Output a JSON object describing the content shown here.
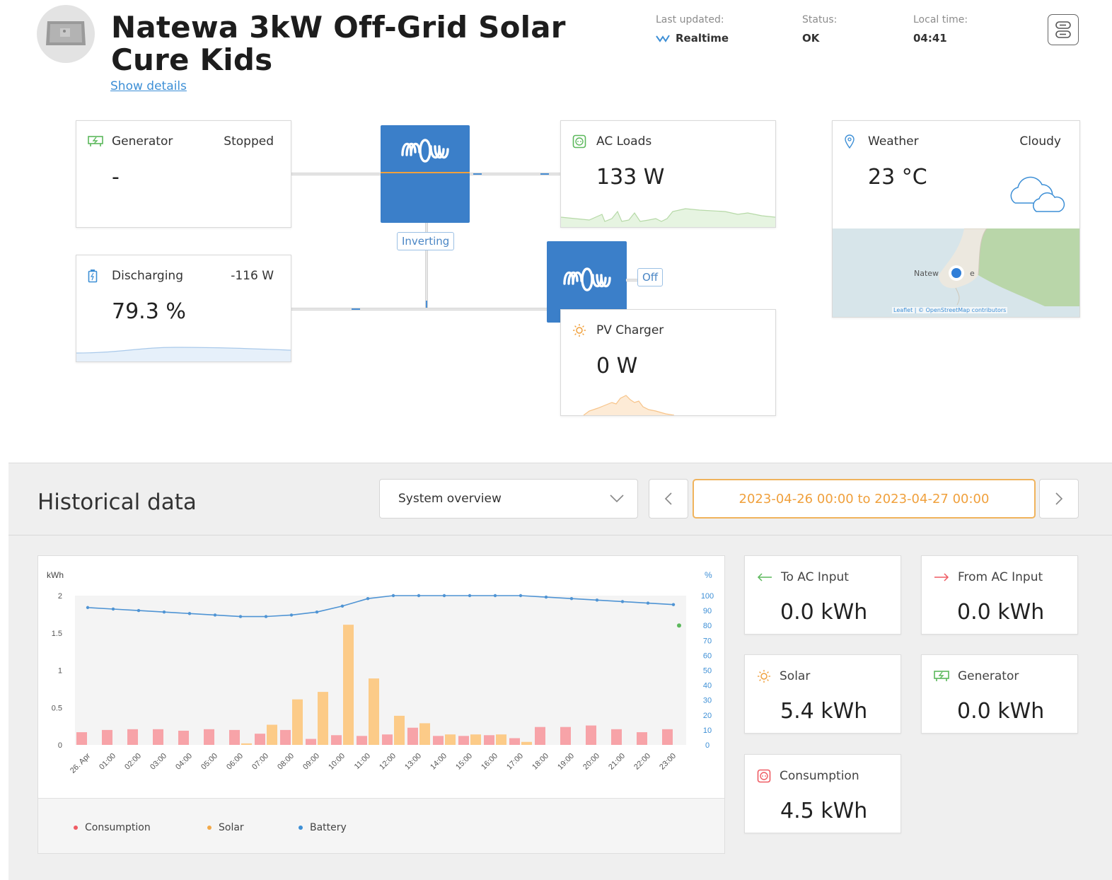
{
  "site": {
    "title": "Natewa 3kW Off-Grid Solar Cure Kids",
    "show_details": "Show details",
    "last_updated_label": "Last updated:",
    "last_updated_value": "Realtime",
    "status_label": "Status:",
    "status_value": "OK",
    "local_time_label": "Local time:",
    "local_time_value": "04:41"
  },
  "widgets": {
    "generator": {
      "label": "Generator",
      "state": "Stopped",
      "value": "-"
    },
    "battery": {
      "label": "Discharging",
      "power": "-116 W",
      "value": "79.3 %"
    },
    "ac_loads": {
      "label": "AC Loads",
      "value": "133 W"
    },
    "pv_charger": {
      "label": "PV Charger",
      "value": "0 W"
    },
    "inverter": {
      "state": "Inverting"
    },
    "solar_charger": {
      "state": "Off"
    },
    "weather": {
      "label": "Weather",
      "condition": "Cloudy",
      "temperature": "23 °C"
    },
    "map": {
      "place_label": "Natew",
      "place_label_2": "e",
      "attribution": "Leaflet | © OpenStreetMap contributors"
    }
  },
  "historical": {
    "title": "Historical data",
    "dropdown_value": "System overview",
    "date_range": "2023-04-26 00:00 to 2023-04-27 00:00"
  },
  "stats": {
    "to_ac_input": {
      "label": "To AC Input",
      "value": "0.0 kWh"
    },
    "from_ac_input": {
      "label": "From AC Input",
      "value": "0.0 kWh"
    },
    "solar": {
      "label": "Solar",
      "value": "5.4 kWh"
    },
    "generator": {
      "label": "Generator",
      "value": "0.0 kWh"
    },
    "consumption": {
      "label": "Consumption",
      "value": "4.5 kWh"
    }
  },
  "colors": {
    "consumption": "#f7a3a8",
    "solar": "#fccb88",
    "battery": "#4f94d4",
    "accent_blue": "#3b7fc9",
    "accent_orange": "#f0a03c"
  },
  "chart_data": {
    "type": "bar",
    "ylabel_left": "kWh",
    "ylabel_right": "%",
    "ylim_left": [
      0,
      2
    ],
    "ylim_right": [
      0,
      100
    ],
    "left_ticks": [
      "0",
      "0.5",
      "1",
      "1.5",
      "2"
    ],
    "right_ticks": [
      "0",
      "10",
      "20",
      "30",
      "40",
      "50",
      "60",
      "70",
      "80",
      "90",
      "100"
    ],
    "categories": [
      "26. Apr",
      "01:00",
      "02:00",
      "03:00",
      "04:00",
      "05:00",
      "06:00",
      "07:00",
      "08:00",
      "09:00",
      "10:00",
      "11:00",
      "12:00",
      "13:00",
      "14:00",
      "15:00",
      "16:00",
      "17:00",
      "18:00",
      "19:00",
      "20:00",
      "21:00",
      "22:00",
      "23:00"
    ],
    "series": [
      {
        "name": "Consumption",
        "axis": "left",
        "values": [
          0.17,
          0.2,
          0.21,
          0.21,
          0.19,
          0.21,
          0.2,
          0.15,
          0.2,
          0.08,
          0.13,
          0.12,
          0.14,
          0.23,
          0.12,
          0.12,
          0.13,
          0.09,
          0.24,
          0.24,
          0.26,
          0.21,
          0.17,
          0.21
        ]
      },
      {
        "name": "Solar",
        "axis": "left",
        "values": [
          0,
          0,
          0,
          0,
          0,
          0,
          0.02,
          0.27,
          0.61,
          0.71,
          1.61,
          0.89,
          0.39,
          0.29,
          0.14,
          0.14,
          0.14,
          0.04,
          0,
          0,
          0,
          0,
          0,
          0
        ]
      },
      {
        "name": "Battery",
        "axis": "right",
        "values": [
          92,
          91,
          90,
          89,
          88,
          87,
          86,
          86,
          87,
          89,
          93,
          98,
          100,
          100,
          100,
          100,
          100,
          100,
          99,
          98,
          97,
          96,
          95,
          94
        ]
      }
    ],
    "marker": {
      "x": "23:00",
      "value": 80
    },
    "legend": [
      "Consumption",
      "Solar",
      "Battery"
    ],
    "legend_position": "bottom",
    "grid": false
  }
}
